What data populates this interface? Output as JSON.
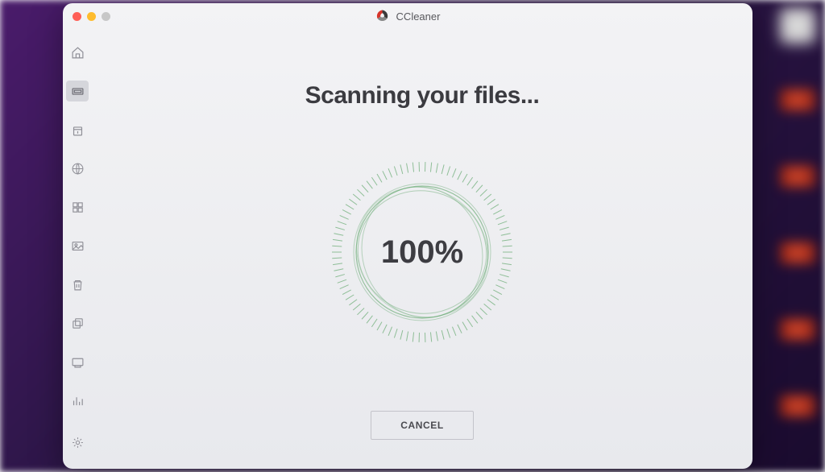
{
  "app": {
    "title": "CCleaner"
  },
  "traffic_lights": {
    "close": "close",
    "minimize": "minimize",
    "maximize": "maximize"
  },
  "sidebar": {
    "items": [
      {
        "name": "home-icon"
      },
      {
        "name": "scan-icon"
      },
      {
        "name": "clean-icon"
      },
      {
        "name": "web-icon"
      },
      {
        "name": "apps-icon"
      },
      {
        "name": "photos-icon"
      },
      {
        "name": "trash-icon"
      },
      {
        "name": "duplicates-icon"
      },
      {
        "name": "uninstaller-icon"
      },
      {
        "name": "analyzer-icon"
      }
    ],
    "bottom": {
      "name": "settings-icon"
    }
  },
  "main": {
    "title": "Scanning your files...",
    "progress_value": 100,
    "progress_text": "100%",
    "cancel_label": "CANCEL"
  },
  "colors": {
    "ring": "#5aa967",
    "text": "#3b3b40"
  }
}
